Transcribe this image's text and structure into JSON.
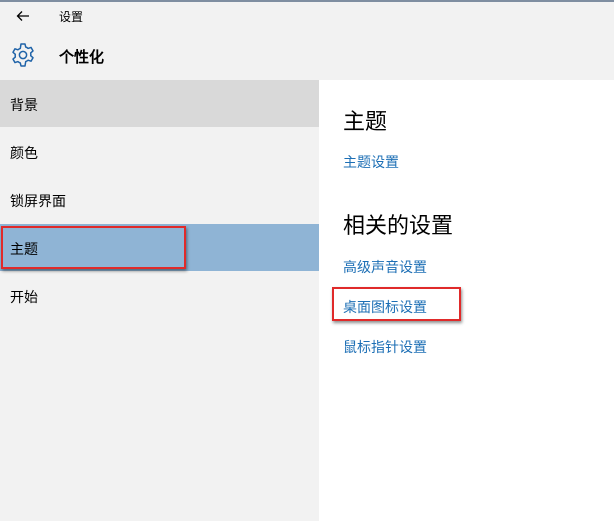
{
  "titlebar": {
    "back_icon": "back-arrow-icon",
    "title": "设置"
  },
  "header": {
    "icon": "gear-icon",
    "title": "个性化"
  },
  "sidebar": {
    "items": [
      {
        "label": "背景",
        "state": "hover"
      },
      {
        "label": "颜色",
        "state": "normal"
      },
      {
        "label": "锁屏界面",
        "state": "normal"
      },
      {
        "label": "主题",
        "state": "selected"
      },
      {
        "label": "开始",
        "state": "normal"
      }
    ]
  },
  "content": {
    "section1_title": "主题",
    "section1_link": "主题设置",
    "section2_title": "相关的设置",
    "links": [
      "高级声音设置",
      "桌面图标设置",
      "鼠标指针设置"
    ]
  },
  "colors": {
    "selected_bg": "#8fb4d5",
    "hover_bg": "#d9d9d9",
    "link": "#1d6fb5",
    "highlight_box": "#e02a2a"
  }
}
